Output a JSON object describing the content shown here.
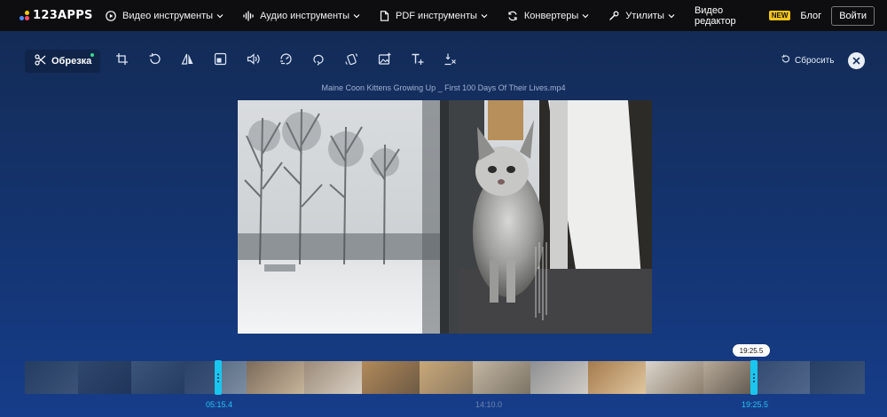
{
  "brand": {
    "name": "123APPS",
    "dot_colors": [
      "#4f8cff",
      "#ffcc00",
      "#ff4d6d"
    ]
  },
  "nav": {
    "items": [
      {
        "label": "Видео инструменты",
        "icon": "video-play-icon"
      },
      {
        "label": "Аудио инструменты",
        "icon": "audio-wave-icon"
      },
      {
        "label": "PDF инструменты",
        "icon": "pdf-document-icon"
      },
      {
        "label": "Конвертеры",
        "icon": "convert-icon"
      },
      {
        "label": "Утилиты",
        "icon": "utilities-icon"
      }
    ],
    "video_editor": "Видео редактор",
    "new_badge": "NEW",
    "blog": "Блог",
    "login": "Войти"
  },
  "toolbar": {
    "active_tool": {
      "label": "Обрезка",
      "icon": "scissors-icon"
    },
    "tools": [
      "crop-icon",
      "rotate-icon",
      "flip-icon",
      "resize-icon",
      "volume-icon",
      "speed-icon",
      "loop-icon",
      "stabilize-icon",
      "add-image-icon",
      "add-text-icon",
      "remove-logo-icon"
    ],
    "reset_label": "Сбросить"
  },
  "video": {
    "filename": "Maine Coon Kittens Growing Up _ First 100 Days Of Their Lives.mp4"
  },
  "timeline": {
    "start_time": "05:15.4",
    "mid_time": "14:10.0",
    "end_time": "19:25.5",
    "tooltip_time": "19:25.5",
    "selection": {
      "start_fraction": 0.234,
      "end_fraction": 0.871
    },
    "accent_color": "#19c6f0"
  }
}
